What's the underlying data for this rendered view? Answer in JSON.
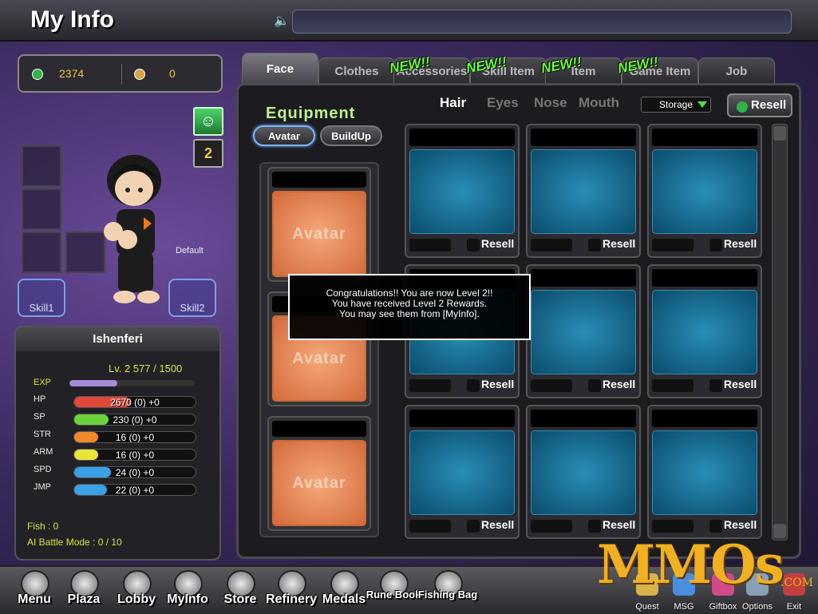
{
  "header": {
    "title": "My Info",
    "speaker_icon": "speaker-icon"
  },
  "currency": {
    "gold_value": "2374",
    "cash_value": "0"
  },
  "avatar": {
    "default_label": "Default",
    "skill1": "Skill1",
    "skill2": "Skill2"
  },
  "stats": {
    "name": "Ishenferi",
    "level_line": "Lv. 2   577 / 1500",
    "exp_label": "EXP",
    "exp_fraction": 0.38,
    "rows": [
      {
        "label": "HP",
        "value": "2670 (0) +0",
        "fill": 0.46,
        "color": "#e0483a"
      },
      {
        "label": "SP",
        "value": "230 (0) +0",
        "fill": 0.28,
        "color": "#6cd43a"
      },
      {
        "label": "STR",
        "value": "16 (0) +0",
        "fill": 0.2,
        "color": "#f08a2a"
      },
      {
        "label": "ARM",
        "value": "16 (0) +0",
        "fill": 0.2,
        "color": "#e8e43a"
      },
      {
        "label": "SPD",
        "value": "24 (0) +0",
        "fill": 0.3,
        "color": "#3aa0e8"
      },
      {
        "label": "JMP",
        "value": "22 (0) +0",
        "fill": 0.27,
        "color": "#3aa0e8"
      }
    ],
    "fish": "Fish : 0",
    "ai_mode": "AI Battle Mode : 0 / 10"
  },
  "tabs": [
    {
      "label": "Face",
      "new": false,
      "active": true
    },
    {
      "label": "Clothes",
      "new": false,
      "active": false
    },
    {
      "label": "Accessories",
      "new": true,
      "active": false
    },
    {
      "label": "Skill Item",
      "new": true,
      "active": false
    },
    {
      "label": "Item",
      "new": true,
      "active": false
    },
    {
      "label": "Game Item",
      "new": true,
      "active": false
    },
    {
      "label": "Job",
      "new": false,
      "active": false
    }
  ],
  "new_tag": "NEW!!",
  "equipment": {
    "title": "Equipment",
    "avatar_btn": "Avatar",
    "buildup_btn": "BuildUp",
    "card_label": "Avatar"
  },
  "subcategories": [
    "Hair",
    "Eyes",
    "Nose",
    "Mouth"
  ],
  "storage": {
    "selected": "Storage"
  },
  "resell_button": "Resell",
  "cell_resell": "Resell",
  "popup": {
    "line1": "Congratulations!! You are now Level 2!!",
    "line2": "You have received Level 2 Rewards.",
    "line3": "You may see them from [MyInfo]."
  },
  "bottom_nav": [
    "Menu",
    "Plaza",
    "Lobby",
    "MyInfo",
    "Store",
    "Refinery",
    "Medals",
    "Rune Book",
    "Fishing Bag"
  ],
  "bottom_right": [
    "Quest",
    "MSG",
    "Giftbox",
    "Options",
    "Exit"
  ],
  "watermark": {
    "main": "MMOs",
    "suffix": ".COM"
  }
}
